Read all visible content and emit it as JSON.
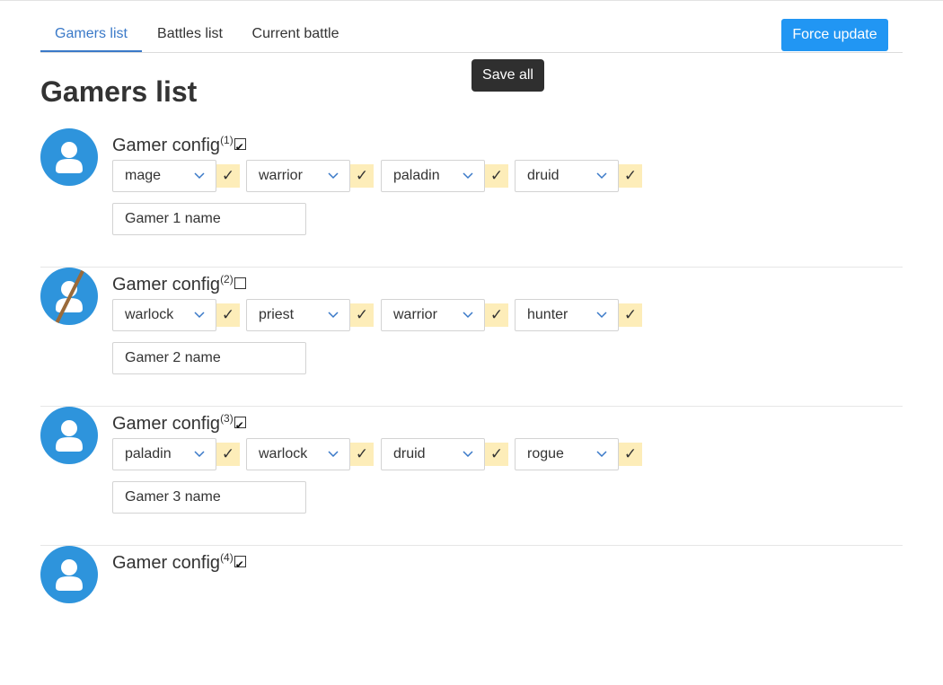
{
  "tabs": [
    {
      "label": "Gamers list",
      "active": true
    },
    {
      "label": "Battles list",
      "active": false
    },
    {
      "label": "Current battle",
      "active": false
    }
  ],
  "toolbar": {
    "force_update_label": "Force update"
  },
  "tooltip": {
    "label": "Save all"
  },
  "page_title": "Gamers list",
  "ok_mark": "✓",
  "colors": {
    "accent": "#2196f3",
    "tab_active": "#3a79c8",
    "avatar": "#2e94dc",
    "ok_bg": "#fdedb9",
    "tooltip_bg": "#2f2f2f"
  },
  "gamers": [
    {
      "title": "Gamer config",
      "index": "(1)",
      "enabled": true,
      "avatar": "user-icon",
      "classes": [
        "mage",
        "warrior",
        "paladin",
        "druid"
      ],
      "name": "Gamer 1 name"
    },
    {
      "title": "Gamer config",
      "index": "(2)",
      "enabled": false,
      "avatar": "user-disabled-icon",
      "classes": [
        "warlock",
        "priest",
        "warrior",
        "hunter"
      ],
      "name": "Gamer 2 name"
    },
    {
      "title": "Gamer config",
      "index": "(3)",
      "enabled": true,
      "avatar": "user-icon",
      "classes": [
        "paladin",
        "warlock",
        "druid",
        "rogue"
      ],
      "name": "Gamer 3 name"
    },
    {
      "title": "Gamer config",
      "index": "(4)",
      "enabled": true,
      "avatar": "user-icon",
      "classes": [],
      "name": ""
    }
  ]
}
